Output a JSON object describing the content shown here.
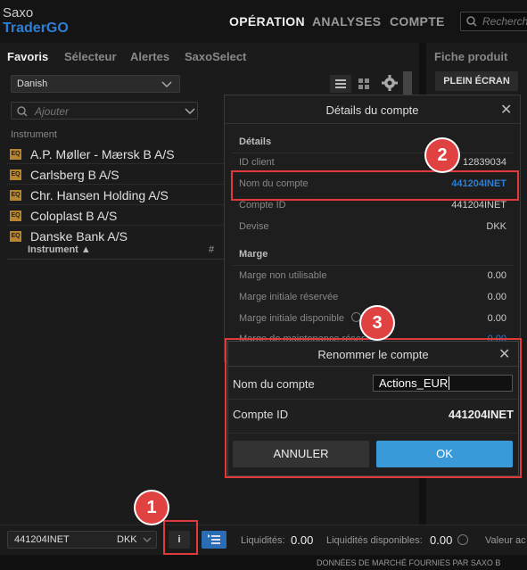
{
  "logo": {
    "line1": "Saxo",
    "line2": "TraderGO"
  },
  "nav": {
    "item1": "OPÉRATION",
    "item2": "ANALYSES",
    "item3": "COMPTE"
  },
  "search": {
    "placeholder": "Recherch"
  },
  "left_tabs": {
    "tab1": "Favoris",
    "tab2": "Sélecteur",
    "tab3": "Alertes",
    "tab4": "SaxoSelect"
  },
  "watchlist": {
    "selected": "Danish",
    "add_placeholder": "Ajouter",
    "col_instrument": "Instrument",
    "sort_instrument": "Instrument ▲",
    "sort_hash": "#",
    "badge": "EQ",
    "items": [
      "A.P. Møller - Mærsk B A/S",
      "Carlsberg B A/S",
      "Chr. Hansen Holding A/S",
      "Coloplast B A/S",
      "Danske Bank A/S"
    ]
  },
  "right_panel": {
    "title": "Fiche produit",
    "fullscreen": "PLEIN ÉCRAN"
  },
  "account_details": {
    "title": "Détails du compte",
    "section_details": "Détails",
    "client_id_label": "ID client",
    "client_id_value": "12839034",
    "account_name_label": "Nom du compte",
    "account_name_value": "441204INET",
    "account_id_label": "Compte ID",
    "account_id_value": "441204INET",
    "currency_label": "Devise",
    "currency_value": "DKK",
    "section_margin": "Marge",
    "m1_label": "Marge non utilisable",
    "m1_value": "0.00",
    "m2_label": "Marge initiale réservée",
    "m2_value": "0.00",
    "m3_label": "Marge initiale disponible",
    "m3_value": "0.00",
    "m4_label": "Marge de maintenance réser",
    "m4_value": "0.00"
  },
  "rename_dialog": {
    "title": "Renommer le compte",
    "name_label": "Nom du compte",
    "name_value": "Actions_EUR",
    "id_label": "Compte ID",
    "id_value": "441204INET",
    "cancel": "ANNULER",
    "ok": "OK"
  },
  "bottom_bar": {
    "account": "441204INET",
    "currency": "DKK",
    "info_btn": "i",
    "liquidity_label": "Liquidités:",
    "liquidity_value": "0.00",
    "available_label": "Liquidités disponibles:",
    "available_value": "0.00",
    "value_label": "Valeur ac"
  },
  "footer": {
    "text": "DONNÉES DE MARCHÉ FOURNIES PAR SAXO B"
  },
  "annotations": {
    "a1": "1",
    "a2": "2",
    "a3": "3"
  },
  "colors": {
    "accent": "#2c7fd6",
    "ok": "#3a9ad9",
    "highlight": "#e03a3a"
  }
}
